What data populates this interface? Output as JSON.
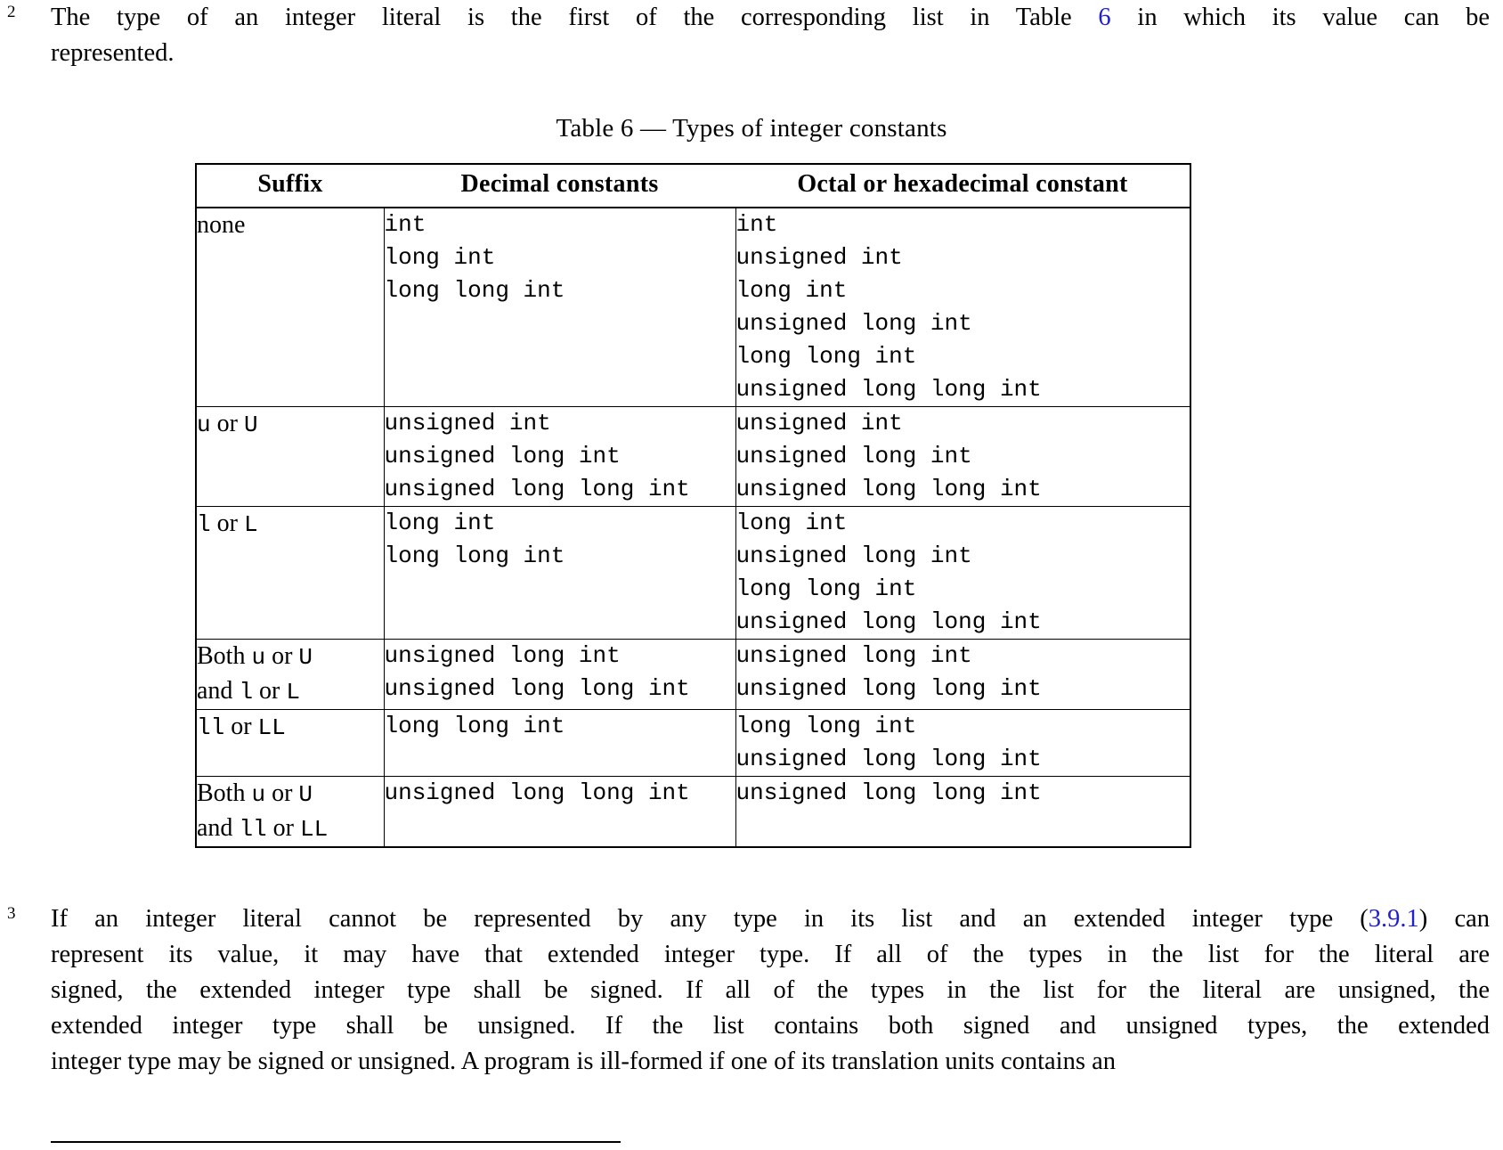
{
  "document": {
    "paragraphs": [
      {
        "number": "2",
        "lines": [
          "The type of an integer literal is the first of the corresponding list in Table ",
          " in which its value can be"
        ],
        "xref": "6",
        "tail": "represented."
      }
    ],
    "table": {
      "caption": "Table 6 — Types of integer constants",
      "headers": [
        "Suffix",
        "Decimal constants",
        "Octal or hexadecimal constant"
      ],
      "rows": [
        {
          "suffix_parts": [
            {
              "text": "none",
              "style": "roman"
            }
          ],
          "decimal": "int\nlong int\nlong long int",
          "octal_hex": "int\nunsigned int\nlong int\nunsigned long int\nlong long int\nunsigned long long int"
        },
        {
          "suffix_parts": [
            {
              "text": "u",
              "style": "mono"
            },
            {
              "text": " or ",
              "style": "roman"
            },
            {
              "text": "U",
              "style": "mono"
            }
          ],
          "decimal": "unsigned int\nunsigned long int\nunsigned long long int",
          "octal_hex": "unsigned int\nunsigned long int\nunsigned long long int"
        },
        {
          "suffix_parts": [
            {
              "text": "l",
              "style": "mono"
            },
            {
              "text": " or ",
              "style": "roman"
            },
            {
              "text": "L",
              "style": "mono"
            }
          ],
          "decimal": "long int\nlong long int",
          "octal_hex": "long int\nunsigned long int\nlong long int\nunsigned long long int"
        },
        {
          "suffix_parts": [
            {
              "text": "Both ",
              "style": "roman"
            },
            {
              "text": "u",
              "style": "mono"
            },
            {
              "text": " or ",
              "style": "roman"
            },
            {
              "text": "U",
              "style": "mono"
            },
            {
              "text": "\n",
              "style": "break"
            },
            {
              "text": "and ",
              "style": "roman"
            },
            {
              "text": "l",
              "style": "mono"
            },
            {
              "text": " or ",
              "style": "roman"
            },
            {
              "text": "L",
              "style": "mono"
            }
          ],
          "decimal": "unsigned long int\nunsigned long long int",
          "octal_hex": "unsigned long int\nunsigned long long int"
        },
        {
          "suffix_parts": [
            {
              "text": "ll",
              "style": "mono"
            },
            {
              "text": " or ",
              "style": "roman"
            },
            {
              "text": "LL",
              "style": "mono"
            }
          ],
          "decimal": "long long int",
          "octal_hex": "long long int\nunsigned long long int"
        },
        {
          "suffix_parts": [
            {
              "text": "Both ",
              "style": "roman"
            },
            {
              "text": "u",
              "style": "mono"
            },
            {
              "text": " or ",
              "style": "roman"
            },
            {
              "text": "U",
              "style": "mono"
            },
            {
              "text": "\n",
              "style": "break"
            },
            {
              "text": "and ",
              "style": "roman"
            },
            {
              "text": "ll",
              "style": "mono"
            },
            {
              "text": " or ",
              "style": "roman"
            },
            {
              "text": "LL",
              "style": "mono"
            }
          ],
          "decimal": "unsigned long long int",
          "octal_hex": "unsigned long long int"
        }
      ]
    },
    "paragraph3": {
      "number": "3",
      "pre_xref": "If an integer literal cannot be represented by any type in its list and an extended integer type (",
      "xref": "3.9.1",
      "lines": [
        ") can",
        "represent its value, it may have that extended integer type.  If all of the types in the list for the literal are",
        "signed, the extended integer type shall be signed.  If all of the types in the list for the literal are unsigned, the",
        "extended integer type shall be unsigned.  If the list contains both signed and unsigned types, the extended",
        "integer type may be signed or unsigned.  A program is ill-formed if one of its translation units contains an"
      ]
    }
  }
}
